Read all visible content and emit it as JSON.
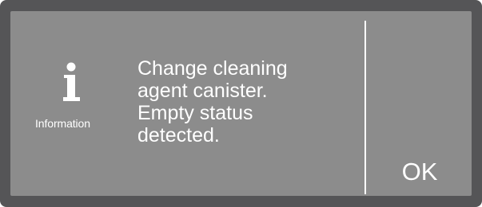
{
  "dialog": {
    "icon": "information-icon",
    "icon_label": "Information",
    "message_lines": [
      "Change cleaning",
      "agent canister.",
      "Empty status",
      "detected."
    ],
    "ok_label": "OK"
  },
  "colors": {
    "bezel": "#555557",
    "screen": "#8c8c8c",
    "text": "#ffffff"
  }
}
